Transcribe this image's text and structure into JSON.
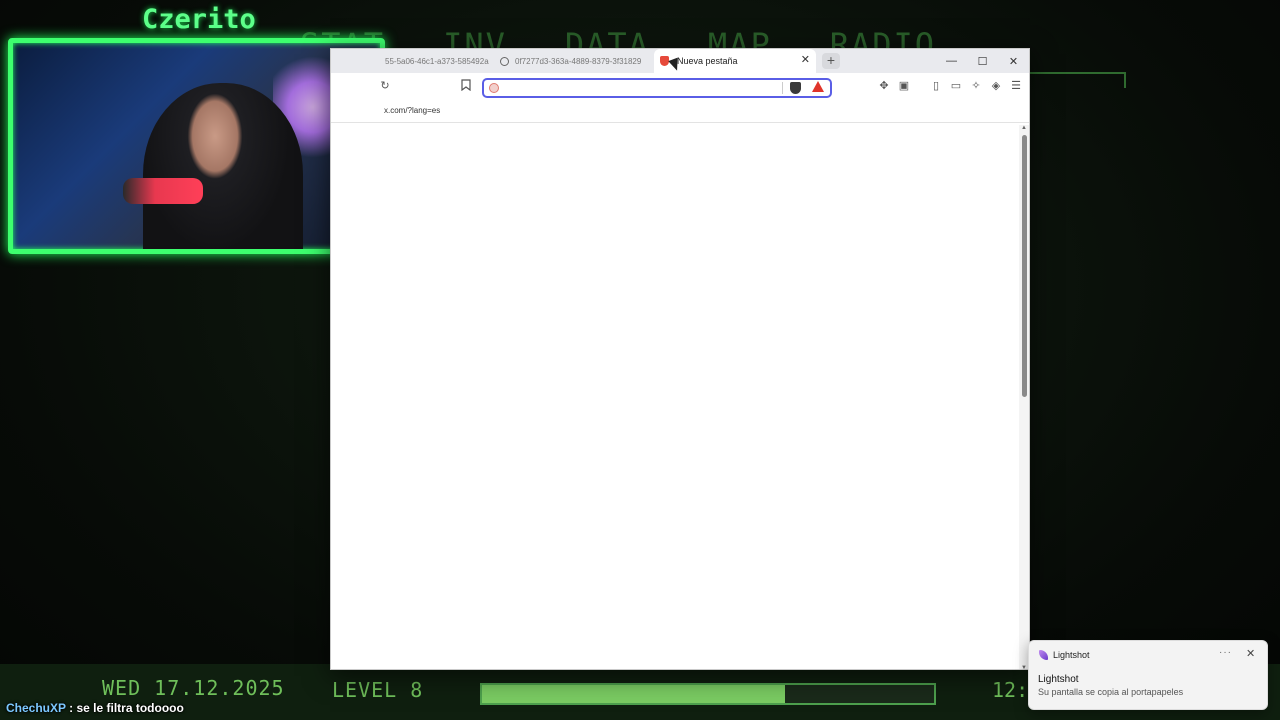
{
  "stream": {
    "streamer_name": "Czerito",
    "chat": {
      "user": "ChechuXP",
      "message": ": se le filtra todoooo"
    }
  },
  "pipboy": {
    "nav_items": [
      "STAT",
      "INV",
      "DATA",
      "MAP",
      "RADIO"
    ],
    "date": "WED 17.12.2025",
    "level": "LEVEL 8",
    "xp_fraction": 0.67,
    "time": "12:"
  },
  "browser": {
    "tabs": [
      {
        "title": "55-5a06-46c1-a373-585492a",
        "icon": "globe-icon"
      },
      {
        "title": "0f7277d3-363a-4889-8379-3f31829",
        "icon": "globe-icon"
      },
      {
        "title": "Nueva pestaña",
        "icon": "brave-icon",
        "active": true
      }
    ],
    "new_tab_label": "+",
    "window_controls": {
      "minimize": "—",
      "maximize": "☐",
      "close": "✕"
    },
    "address": {
      "value": "",
      "placeholder": ""
    },
    "bookmark": "x.com/?lang=es"
  },
  "toast": {
    "app_name": "Lightshot",
    "more": "···",
    "close": "✕",
    "title": "Lightshot",
    "body": "Su pantalla se copia al portapapeles"
  },
  "colors": {
    "pip_green": "#6fbf5a",
    "webcam_border": "#3dff6e",
    "address_focus": "#5a5ee6"
  }
}
